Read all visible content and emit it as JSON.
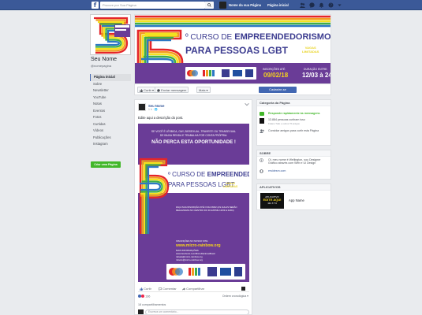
{
  "topbar": {
    "search_placeholder": "Procure por Sua Página",
    "page_link": "Nome da sua Página",
    "home_link": "Página inicial",
    "brand_color": "#3b5998"
  },
  "left": {
    "page_name": "Seu Nome",
    "handle": "@nomepagina",
    "nav": [
      "Página inicial",
      "Sobre",
      "Newsletter",
      "YouTube",
      "Notas",
      "Eventos",
      "Fotos",
      "Curtidas",
      "Vídeos",
      "Publicações",
      "Instagram"
    ],
    "create_button": "Criar uma Página"
  },
  "cover": {
    "title_prefix": "º CURSO DE",
    "title_emph": "EMPREENDEDORISMO",
    "subtitle": "PARA PESSOAS LGBT",
    "badge_line1": "VAGAS",
    "badge_line2": "LIMITADAS",
    "ins_label": "INSCRIÇÕES ATÉ:",
    "ins_date": "09/02/18",
    "dur_label": "DURAÇÃO ENTRE:",
    "dur_date": "12/03 à 24/04"
  },
  "actions": {
    "like": "Curtir ▾",
    "message": "Enviar mensagem",
    "more": "Mais ▾",
    "cta": "Cadastre-se"
  },
  "post": {
    "author": "Seu Nome",
    "meta": "1 h · 🌐",
    "text": "Edite aqui a descrição do post.",
    "img_line1": "SE VOCÊ É LÉSBICA, GAY, BISSEXUAL, TRAVESTI OU TRANSEXUAL",
    "img_line2": "DE BAIXA RENDA E TRABALHA POR CONTA PRÓPRIA:",
    "img_big": "NÃO PERCA ESTA OPORTUNIDADE !",
    "img_t1_prefix": "º CURSO DE",
    "img_t1_emph": "EMPREENDEDORISMO",
    "img_t2": "PARA PESSOAS LGBT",
    "img_vagas1": "VAGAS",
    "img_vagas2": "LIMITADAS",
    "img_small1": "FAÇA SUA INSCRIÇÃO ATÉ O DIA 09/02 (AS AULAS SERÃO",
    "img_small2": "REALIZADAS NO CENTRO DO RJ ENTRE 12/03 E 24/04)",
    "img_small3": "INSCRIÇÕES NO NOSSO SITE:",
    "img_url": "www.micro-rainbow.org",
    "img_small4": "MAIS INFORMAÇÕES:",
    "img_small5": "www.facebook.com/MicroRainbowBrasil",
    "img_small6": "rafaela@micro-rainbow.org",
    "img_small7": "roberto@micro-rainbow.org",
    "react_like": "Curtir",
    "react_comment": "Comentar",
    "react_share": "Compartilhar",
    "like_count": "136",
    "sort_label": "Ordem cronológica ▾",
    "shares": "18 compartilhamentos",
    "comment_placeholder": "Escreva um comentário..."
  },
  "right": {
    "category_head": "Categoria da Página",
    "responds": "Responde rapidamente às mensagens",
    "likes_count": "13.884 pessoas curtiram isso",
    "likes_sub": "Fulano Tulio e outros 76 amigos",
    "invite": "Convidar amigos para curtir esta Página",
    "sobre_head": "SOBRE",
    "sobre_text": "Oi, meu nome é Wellington, sou Designer Gráfico através com Web e UI Design",
    "sobre_link": "ersidesm.com",
    "apps_head": "APLICATIVOS",
    "app_name": "App Name",
    "app_thumb1": "APLICATIVO",
    "app_thumb2": "EDITE AQUI",
    "app_thumb3": "111 X 74"
  }
}
